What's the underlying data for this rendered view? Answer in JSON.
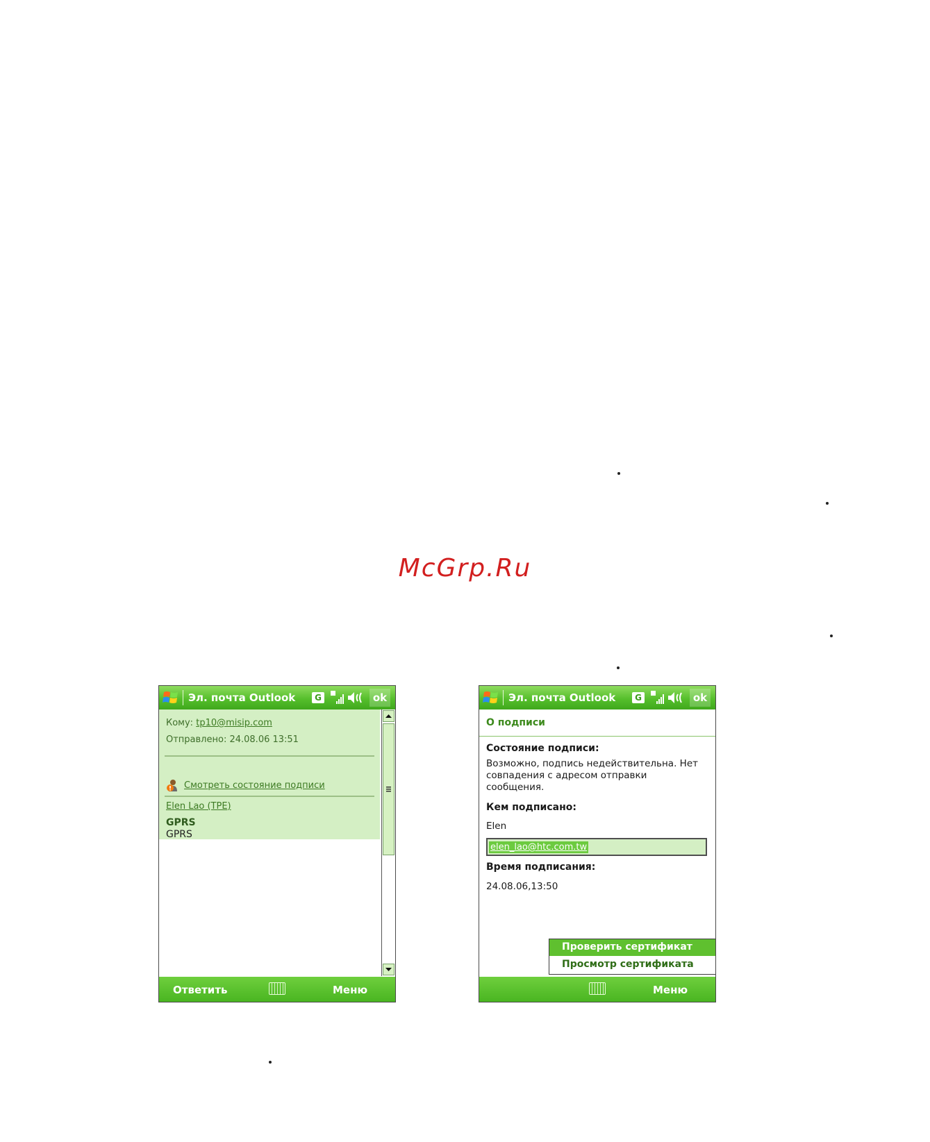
{
  "watermark": "McGrp.Ru",
  "status_icons": {
    "network": "G"
  },
  "left_screen": {
    "title": "Эл. почта Outlook",
    "ok_label": "ok",
    "to_label": "Кому:",
    "to_value": "tp10@misip.com",
    "sent_label": "Отправлено:",
    "sent_value": "24.08.06 13:51",
    "signature_link": "Смотреть состояние подписи",
    "sender": "Elen Lao (TPE)",
    "subject": "GPRS",
    "body": "GPRS",
    "softkey_left": "Ответить",
    "softkey_right": "Меню"
  },
  "right_screen": {
    "title": "Эл. почта Outlook",
    "ok_label": "ok",
    "section_title": "О подписи",
    "status_label": "Состояние подписи:",
    "status_text": "Возможно, подпись недействительна. Нет совпадения с адресом отправки сообщения.",
    "signed_by_label": "Кем подписано:",
    "signed_by_name": "Elen",
    "signed_by_email": "elen_lao@htc.com.tw",
    "time_label": "Время подписания:",
    "time_value": "24.08.06,13:50",
    "menu_items": [
      "Проверить сертификат",
      "Просмотр сертификата"
    ],
    "softkey_right": "Меню"
  }
}
